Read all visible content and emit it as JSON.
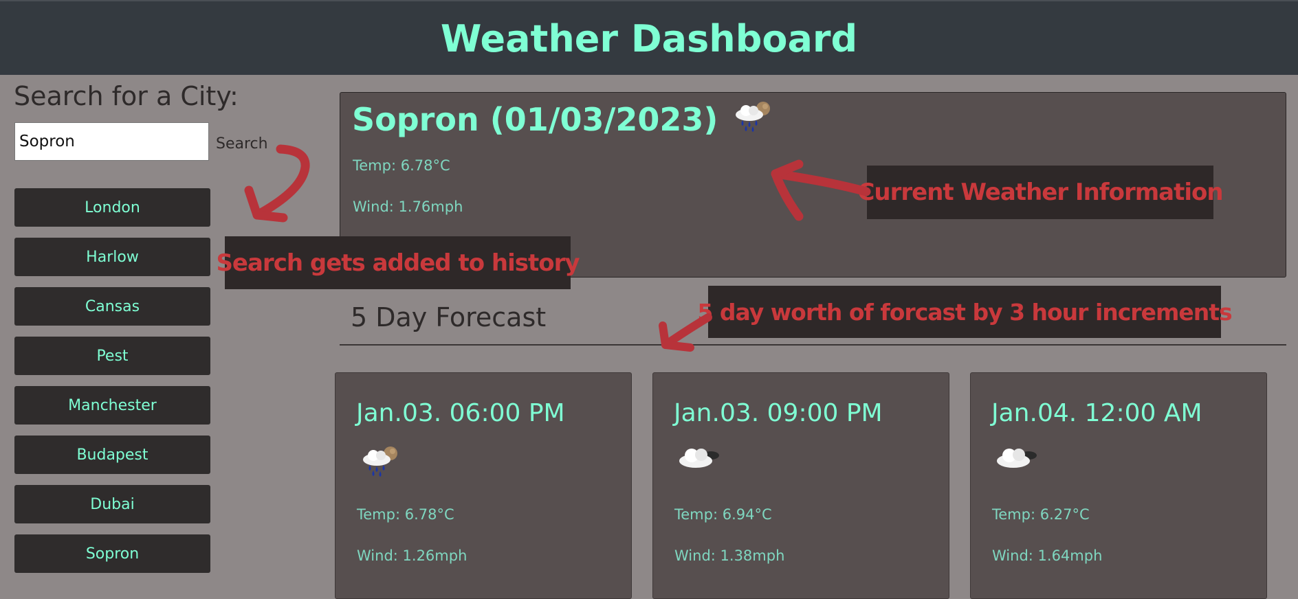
{
  "header": {
    "title": "Weather Dashboard"
  },
  "search": {
    "heading": "Search for a City:",
    "input_value": "Sopron",
    "button_label": "Search"
  },
  "history": [
    "London",
    "Harlow",
    "Cansas",
    "Pest",
    "Manchester",
    "Budapest",
    "Dubai",
    "Sopron"
  ],
  "current": {
    "title": "Sopron (01/03/2023)",
    "icon": "rain-cloud-sun-icon",
    "temp": "Temp: 6.78°C",
    "wind": "Wind: 1.76mph"
  },
  "forecast": {
    "heading": "5 Day Forecast",
    "cards": [
      {
        "date": "Jan.03. 06:00 PM",
        "icon": "rain-cloud-sun-icon",
        "temp": "Temp: 6.78°C",
        "wind": "Wind: 1.26mph"
      },
      {
        "date": "Jan.03. 09:00 PM",
        "icon": "cloud-icon",
        "temp": "Temp: 6.94°C",
        "wind": "Wind: 1.38mph"
      },
      {
        "date": "Jan.04. 12:00 AM",
        "icon": "cloud-icon",
        "temp": "Temp: 6.27°C",
        "wind": "Wind: 1.64mph"
      }
    ]
  },
  "annotations": {
    "history": "Search gets added to history",
    "current": "Current Weather Information",
    "forecast": "5 day worth of forcast by 3 hour increments"
  },
  "colors": {
    "accent": "#7fffd4",
    "header_bg": "#343a40",
    "page_bg": "#8e8888",
    "card_bg": "#574f4f",
    "annotation_red": "#c9393c"
  }
}
